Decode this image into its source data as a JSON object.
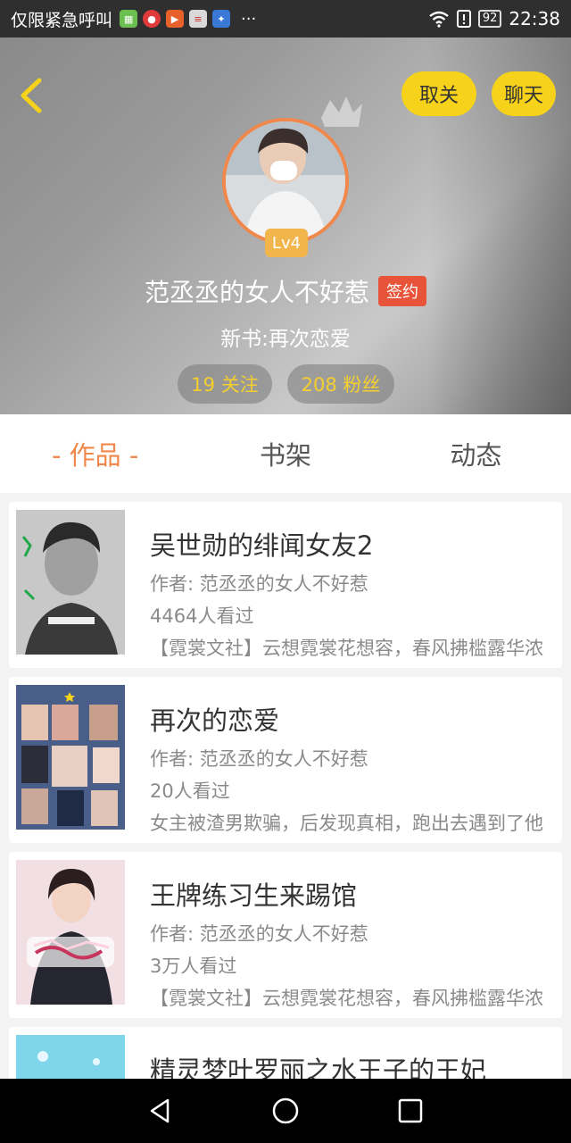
{
  "status_bar": {
    "carrier": "仅限紧急呼叫",
    "battery": "92",
    "time": "22:38",
    "icons": [
      "wechat-icon",
      "video-icon",
      "player-icon",
      "news-icon",
      "baidu-icon",
      "more-dots-icon",
      "wifi-icon",
      "alert-icon",
      "battery-icon"
    ]
  },
  "header": {
    "unfollow_label": "取关",
    "chat_label": "聊天",
    "level": "Lv4",
    "author_name": "范丞丞的女人不好惹",
    "signed_badge": "签约",
    "new_book": "新书:再次恋爱",
    "following": "19 关注",
    "fans": "208 粉丝",
    "accent_color": "#f6d21a"
  },
  "tabs": [
    {
      "label": "- 作品 -",
      "active": true
    },
    {
      "label": "书架",
      "active": false
    },
    {
      "label": "动态",
      "active": false
    }
  ],
  "books": [
    {
      "title": "吴世勋的绯闻女友2",
      "author": "作者: 范丞丞的女人不好惹",
      "reads": "4464人看过",
      "desc": "【霓裳文社】云想霓裳花想容，春风拂槛露华浓"
    },
    {
      "title": "再次的恋爱",
      "author": "作者: 范丞丞的女人不好惹",
      "reads": "20人看过",
      "desc": "女主被渣男欺骗，后发现真相，跑出去遇到了他"
    },
    {
      "title": "王牌练习生来踢馆",
      "author": "作者: 范丞丞的女人不好惹",
      "reads": "3万人看过",
      "desc": "【霓裳文社】云想霓裳花想容，春风拂槛露华浓"
    },
    {
      "title": "精灵梦叶罗丽之水王子的王妃",
      "author": "",
      "reads": "",
      "desc": ""
    }
  ],
  "nav": [
    "back-triangle-icon",
    "home-circle-icon",
    "recent-square-icon"
  ]
}
